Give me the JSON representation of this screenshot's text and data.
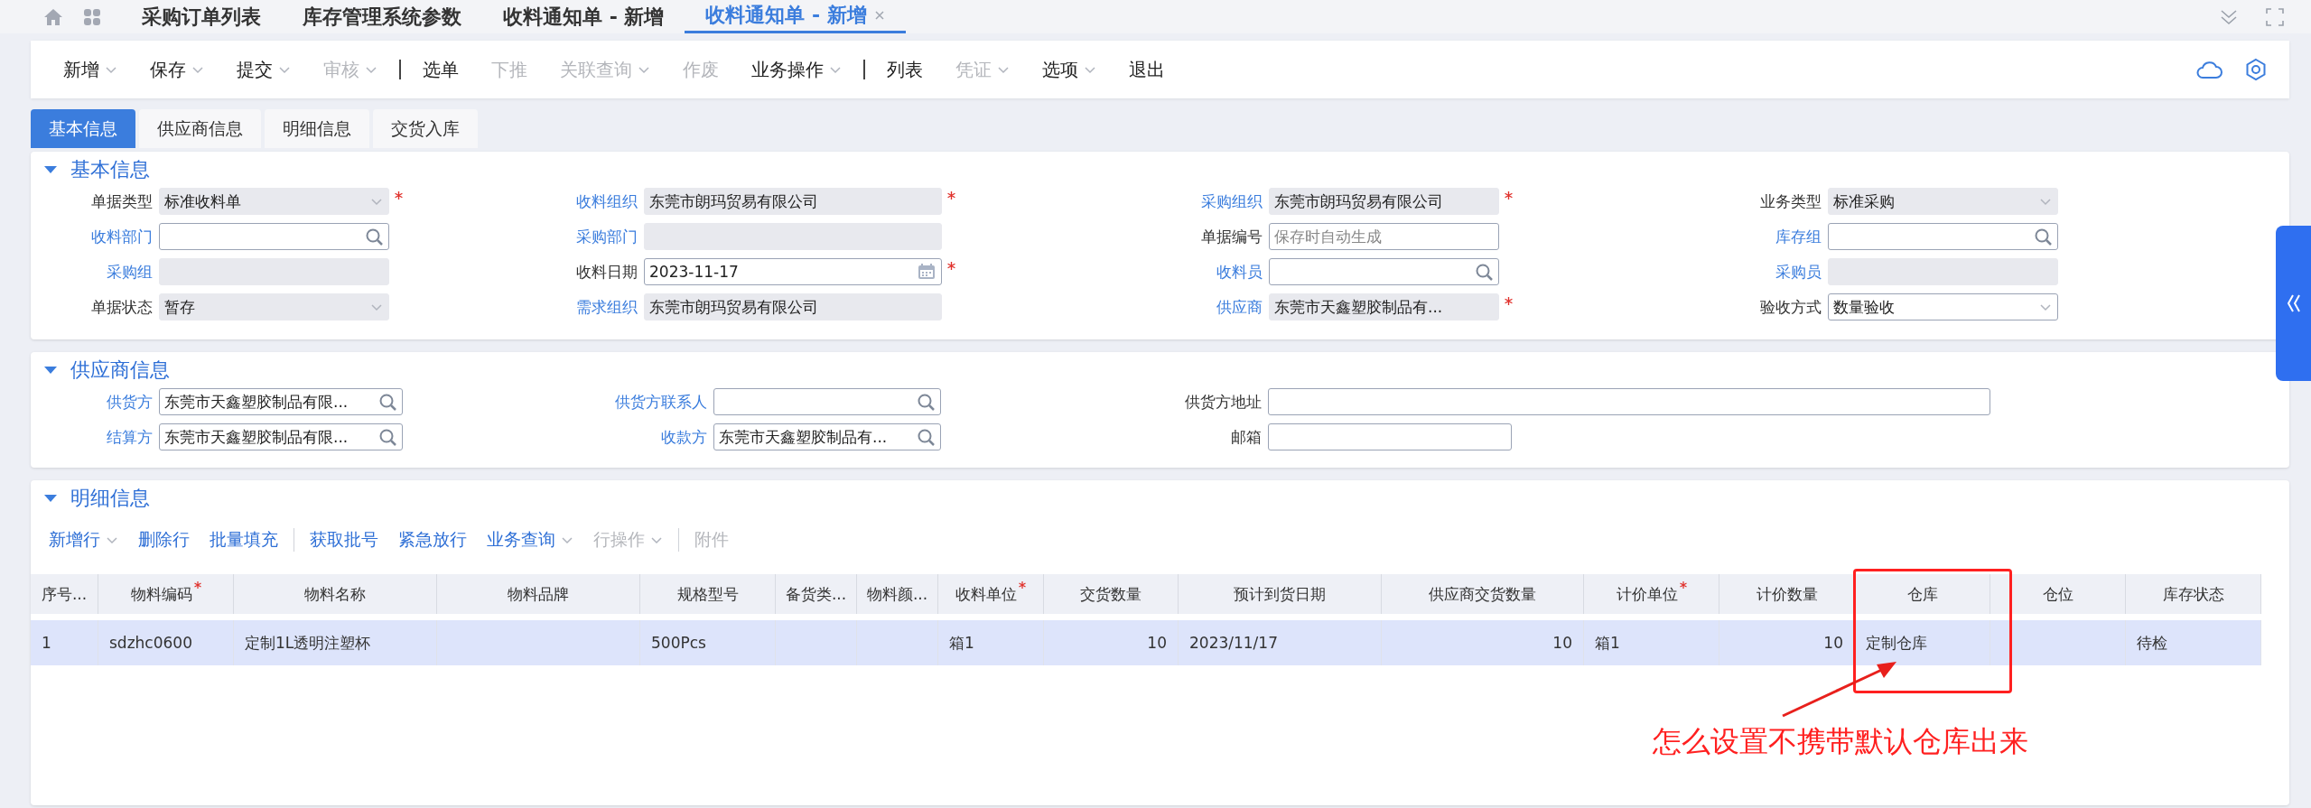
{
  "top_tabs": [
    {
      "label": "采购订单列表",
      "selected": false,
      "closable": false
    },
    {
      "label": "库存管理系统参数",
      "selected": false,
      "closable": false
    },
    {
      "label": "收料通知单 - 新增",
      "selected": false,
      "closable": false
    },
    {
      "label": "收料通知单 - 新增",
      "selected": true,
      "closable": true
    }
  ],
  "toolbar": [
    {
      "kind": "button",
      "label": "新增",
      "disabled": false,
      "dropdown": true
    },
    {
      "kind": "button",
      "label": "保存",
      "disabled": false,
      "dropdown": true
    },
    {
      "kind": "button",
      "label": "提交",
      "disabled": false,
      "dropdown": true
    },
    {
      "kind": "button",
      "label": "审核",
      "disabled": true,
      "dropdown": true
    },
    {
      "kind": "separator"
    },
    {
      "kind": "button",
      "label": "选单",
      "disabled": false,
      "dropdown": false
    },
    {
      "kind": "button",
      "label": "下推",
      "disabled": true,
      "dropdown": false
    },
    {
      "kind": "button",
      "label": "关联查询",
      "disabled": true,
      "dropdown": true
    },
    {
      "kind": "button",
      "label": "作废",
      "disabled": true,
      "dropdown": false
    },
    {
      "kind": "button",
      "label": "业务操作",
      "disabled": false,
      "dropdown": true
    },
    {
      "kind": "separator"
    },
    {
      "kind": "button",
      "label": "列表",
      "disabled": false,
      "dropdown": false
    },
    {
      "kind": "button",
      "label": "凭证",
      "disabled": true,
      "dropdown": true
    },
    {
      "kind": "button",
      "label": "选项",
      "disabled": false,
      "dropdown": true
    },
    {
      "kind": "button",
      "label": "退出",
      "disabled": false,
      "dropdown": false
    }
  ],
  "sub_tabs": [
    {
      "label": "基本信息",
      "selected": true
    },
    {
      "label": "供应商信息",
      "selected": false
    },
    {
      "label": "明细信息",
      "selected": false
    },
    {
      "label": "交货入库",
      "selected": false
    }
  ],
  "basic_info": {
    "title": "基本信息",
    "expanded": true,
    "fields": [
      {
        "label": "单据类型",
        "link": false,
        "kind": "select",
        "disabled": true,
        "required": true,
        "value": "标准收料单"
      },
      {
        "label": "收料组织",
        "link": true,
        "kind": "text",
        "disabled": true,
        "required": true,
        "value": "东莞市朗玛贸易有限公司"
      },
      {
        "label": "采购组织",
        "link": true,
        "kind": "text",
        "disabled": true,
        "required": true,
        "value": "东莞市朗玛贸易有限公司"
      },
      {
        "label": "业务类型",
        "link": false,
        "kind": "select",
        "disabled": true,
        "required": false,
        "value": "标准采购"
      },
      {
        "label": "收料部门",
        "link": true,
        "kind": "lookup",
        "disabled": false,
        "required": false
      },
      {
        "label": "采购部门",
        "link": true,
        "kind": "text",
        "disabled": true,
        "required": false
      },
      {
        "label": "单据编号",
        "link": false,
        "kind": "text",
        "disabled": false,
        "required": false,
        "placeholder": "保存时自动生成"
      },
      {
        "label": "库存组",
        "link": true,
        "kind": "lookup",
        "disabled": false,
        "required": false
      },
      {
        "label": "采购组",
        "link": true,
        "kind": "text",
        "disabled": true,
        "required": false
      },
      {
        "label": "收料日期",
        "link": false,
        "kind": "date",
        "disabled": false,
        "required": true,
        "value": "2023-11-17"
      },
      {
        "label": "收料员",
        "link": true,
        "kind": "lookup",
        "disabled": false,
        "required": false
      },
      {
        "label": "采购员",
        "link": true,
        "kind": "text",
        "disabled": true,
        "required": false
      },
      {
        "label": "单据状态",
        "link": false,
        "kind": "select",
        "disabled": true,
        "required": false,
        "value": "暂存"
      },
      {
        "label": "需求组织",
        "link": true,
        "kind": "text",
        "disabled": true,
        "required": false,
        "value": "东莞市朗玛贸易有限公司"
      },
      {
        "label": "供应商",
        "link": true,
        "kind": "text",
        "disabled": true,
        "required": true,
        "value": "东莞市天鑫塑胶制品有..."
      },
      {
        "label": "验收方式",
        "link": false,
        "kind": "select",
        "disabled": false,
        "required": false,
        "value": "数量验收"
      }
    ]
  },
  "supplier_info": {
    "title": "供应商信息",
    "expanded": true,
    "fields": [
      {
        "label": "供货方",
        "link": true,
        "kind": "lookup",
        "value": "东莞市天鑫塑胶制品有限..."
      },
      {
        "label": "供货方联系人",
        "link": true,
        "kind": "lookup"
      },
      {
        "label": "供货方地址",
        "link": false,
        "kind": "wide"
      },
      {
        "label": "结算方",
        "link": true,
        "kind": "lookup",
        "value": "东莞市天鑫塑胶制品有限..."
      },
      {
        "label": "收款方",
        "link": true,
        "kind": "lookup",
        "value": "东莞市天鑫塑胶制品有..."
      },
      {
        "label": "邮箱",
        "link": false,
        "kind": "text"
      }
    ]
  },
  "detail_info": {
    "title": "明细信息",
    "expanded": true,
    "toolbar": [
      {
        "kind": "button",
        "label": "新增行",
        "disabled": false,
        "dropdown": true
      },
      {
        "kind": "button",
        "label": "删除行",
        "disabled": false,
        "dropdown": false
      },
      {
        "kind": "button",
        "label": "批量填充",
        "disabled": false,
        "dropdown": false
      },
      {
        "kind": "separator"
      },
      {
        "kind": "button",
        "label": "获取批号",
        "disabled": false,
        "dropdown": false
      },
      {
        "kind": "button",
        "label": "紧急放行",
        "disabled": false,
        "dropdown": false
      },
      {
        "kind": "button",
        "label": "业务查询",
        "disabled": false,
        "dropdown": true
      },
      {
        "kind": "button",
        "label": "行操作",
        "disabled": true,
        "dropdown": true
      },
      {
        "kind": "separator"
      },
      {
        "kind": "button",
        "label": "附件",
        "disabled": true,
        "dropdown": false
      }
    ],
    "table": {
      "columns": [
        {
          "label": "序号...",
          "required": false,
          "kind": "text"
        },
        {
          "label": "物料编码",
          "required": true,
          "kind": "text"
        },
        {
          "label": "物料名称",
          "required": false,
          "kind": "text"
        },
        {
          "label": "物料品牌",
          "required": false,
          "kind": "text"
        },
        {
          "label": "规格型号",
          "required": false,
          "kind": "text"
        },
        {
          "label": "备货类...",
          "required": false,
          "kind": "text"
        },
        {
          "label": "物料颜...",
          "required": false,
          "kind": "text"
        },
        {
          "label": "收料单位",
          "required": true,
          "kind": "text"
        },
        {
          "label": "交货数量",
          "required": false,
          "kind": "number"
        },
        {
          "label": "预计到货日期",
          "required": false,
          "kind": "text"
        },
        {
          "label": "供应商交货数量",
          "required": false,
          "kind": "number"
        },
        {
          "label": "计价单位",
          "required": true,
          "kind": "text"
        },
        {
          "label": "计价数量",
          "required": false,
          "kind": "number"
        },
        {
          "label": "仓库",
          "required": false,
          "kind": "text"
        },
        {
          "label": "仓位",
          "required": false,
          "kind": "text"
        },
        {
          "label": "库存状态",
          "required": false,
          "kind": "text"
        }
      ],
      "rows": [
        {
          "selected": true,
          "cells": [
            "1",
            "sdzhc0600",
            "定制1L透明注塑杯",
            "",
            "500Pcs",
            "",
            "",
            "箱1",
            "10",
            "2023/11/17",
            "10",
            "箱1",
            "10",
            "定制仓库",
            "",
            "待检"
          ]
        }
      ]
    }
  },
  "annotation": {
    "text": "怎么设置不携带默认仓库出来"
  }
}
